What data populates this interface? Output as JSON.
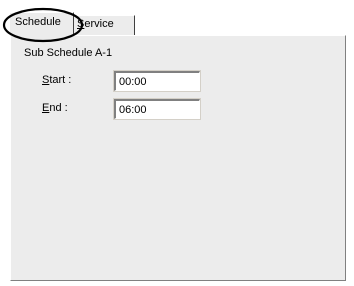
{
  "tabs": [
    {
      "label": "Schedule",
      "mnemonic": "",
      "rest": "Schedule",
      "active": true
    },
    {
      "label": "Service",
      "mnemonic": "S",
      "rest": "ervice",
      "active": false
    }
  ],
  "panel": {
    "group_title": "Sub Schedule A-1",
    "fields": [
      {
        "label": "Start :",
        "mnemonic": "S",
        "rest": "tart :",
        "value": "00:00"
      },
      {
        "label": "End :",
        "mnemonic": "E",
        "rest": "nd :",
        "value": "06:00"
      }
    ]
  },
  "annotation": {
    "type": "ellipse-highlight",
    "target": "Schedule tab",
    "color": "#000000"
  }
}
